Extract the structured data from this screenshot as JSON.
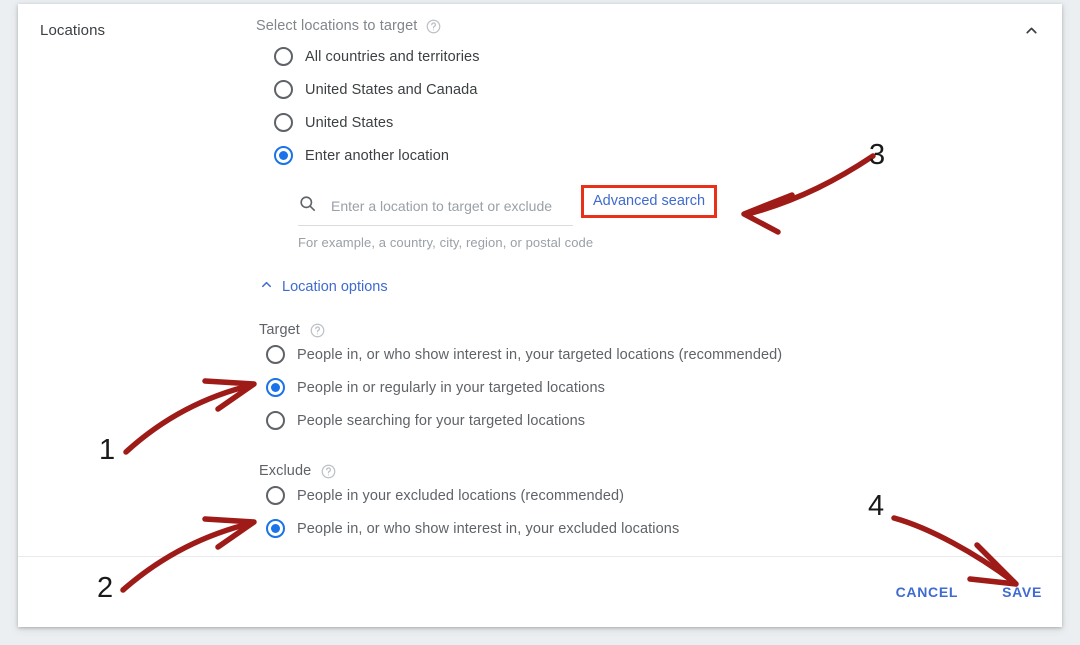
{
  "card": {
    "section_label": "Locations",
    "collapse_icon": "chevron-up-icon"
  },
  "target_selector": {
    "title": "Select locations to target",
    "help_icon": "help-circle-icon",
    "options": [
      {
        "label": "All countries and territories",
        "selected": false
      },
      {
        "label": "United States and Canada",
        "selected": false
      },
      {
        "label": "United States",
        "selected": false
      },
      {
        "label": "Enter another location",
        "selected": true
      }
    ]
  },
  "search": {
    "icon": "search-icon",
    "placeholder": "Enter a location to target or exclude",
    "value": "",
    "hint": "For example, a country, city, region, or postal code",
    "advanced_search_label": "Advanced search",
    "highlight_color": "#e8301b"
  },
  "location_options": {
    "label": "Location options",
    "icon": "chevron-up-icon",
    "expanded": true
  },
  "target_group": {
    "title": "Target",
    "help_icon": "help-circle-icon",
    "options": [
      {
        "label": "People in, or who show interest in, your targeted locations (recommended)",
        "selected": false
      },
      {
        "label": "People in or regularly in your targeted locations",
        "selected": true
      },
      {
        "label": "People searching for your targeted locations",
        "selected": false
      }
    ]
  },
  "exclude_group": {
    "title": "Exclude",
    "help_icon": "help-circle-icon",
    "options": [
      {
        "label": "People in your excluded locations (recommended)",
        "selected": false
      },
      {
        "label": "People in, or who show interest in, your excluded locations",
        "selected": true
      }
    ]
  },
  "footer": {
    "cancel_label": "CANCEL",
    "save_label": "SAVE"
  },
  "annotations": {
    "color": "#9e1b17",
    "steps": [
      {
        "number": "1",
        "points_to": "People in or regularly in your targeted locations"
      },
      {
        "number": "2",
        "points_to": "People in, or who show interest in, your excluded locations"
      },
      {
        "number": "3",
        "points_to": "Advanced search"
      },
      {
        "number": "4",
        "points_to": "SAVE"
      }
    ]
  },
  "theme": {
    "accent": "#1a73e8",
    "link": "#3f6ad0",
    "text": "#3c4043",
    "muted": "#5f6368"
  }
}
